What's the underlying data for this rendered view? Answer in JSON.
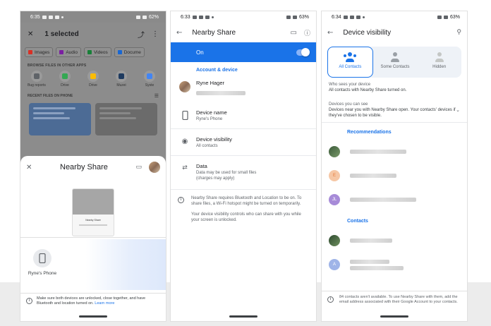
{
  "phone1": {
    "status": {
      "time": "6:35",
      "battery": "62%"
    },
    "files_app": {
      "title": "1 selected",
      "chips": [
        "Images",
        "Audio",
        "Videos",
        "Docume"
      ],
      "browse_header": "BROWSE FILES IN OTHER APPS",
      "apps": [
        "Bug reports",
        "Drive",
        "Drive",
        "Muzei",
        "Syste"
      ],
      "recent_header": "RECENT FILES ON PHONE"
    },
    "sheet": {
      "title": "Nearby Share",
      "preview_title": "Nearby Share",
      "device_name": "Ryne's Phone",
      "note": "Make sure both devices are unlocked, close together, and have Bluetooth and location turned on.",
      "learn_more": "Learn more"
    }
  },
  "phone2": {
    "status": {
      "time": "6:33",
      "battery": "63%"
    },
    "title": "Nearby Share",
    "toggle_label": "On",
    "section_title": "Account & device",
    "account_name": "Ryne Hager",
    "device_name_label": "Device name",
    "device_name_value": "Ryne's Phone",
    "visibility_label": "Device visibility",
    "visibility_value": "All contacts",
    "data_label": "Data",
    "data_value": "Data may be used for small files (charges may apply)",
    "info_p1": "Nearby Share requires Bluetooth and Location to be on. To share files, a Wi-Fi hotspot might be turned on temporarily.",
    "info_p2": "Your device visibility controls who can share with you while your screen is unlocked."
  },
  "phone3": {
    "status": {
      "time": "6:34",
      "battery": "63%"
    },
    "title": "Device visibility",
    "options": [
      "All Contacts",
      "Some Contacts",
      "Hidden"
    ],
    "who_sees_label": "Who sees your device",
    "who_sees_value": "All contacts with Nearby Share turned on.",
    "devices_label": "Devices you can see",
    "devices_value": "Devices near you with Nearby Share open. Your contacts' devices if they've chosen to be visible.",
    "recommendations_title": "Recommendations",
    "contacts_title": "Contacts",
    "avatar_initials": [
      "E",
      "JL",
      "A"
    ],
    "note": "84 contacts aren't available. To use Nearby Share with them, add the email address associated with their Google Account to your contacts."
  },
  "colors": {
    "accent": "#1a73e8",
    "accent_light": "#8ab4f8",
    "page_bg": "#ececec"
  },
  "icons": [
    "close-icon",
    "share-icon",
    "more-vert-icon",
    "feedback-icon",
    "back-arrow-icon",
    "help-icon",
    "search-icon",
    "phone-icon",
    "eye-icon",
    "data-icon",
    "info-icon"
  ]
}
